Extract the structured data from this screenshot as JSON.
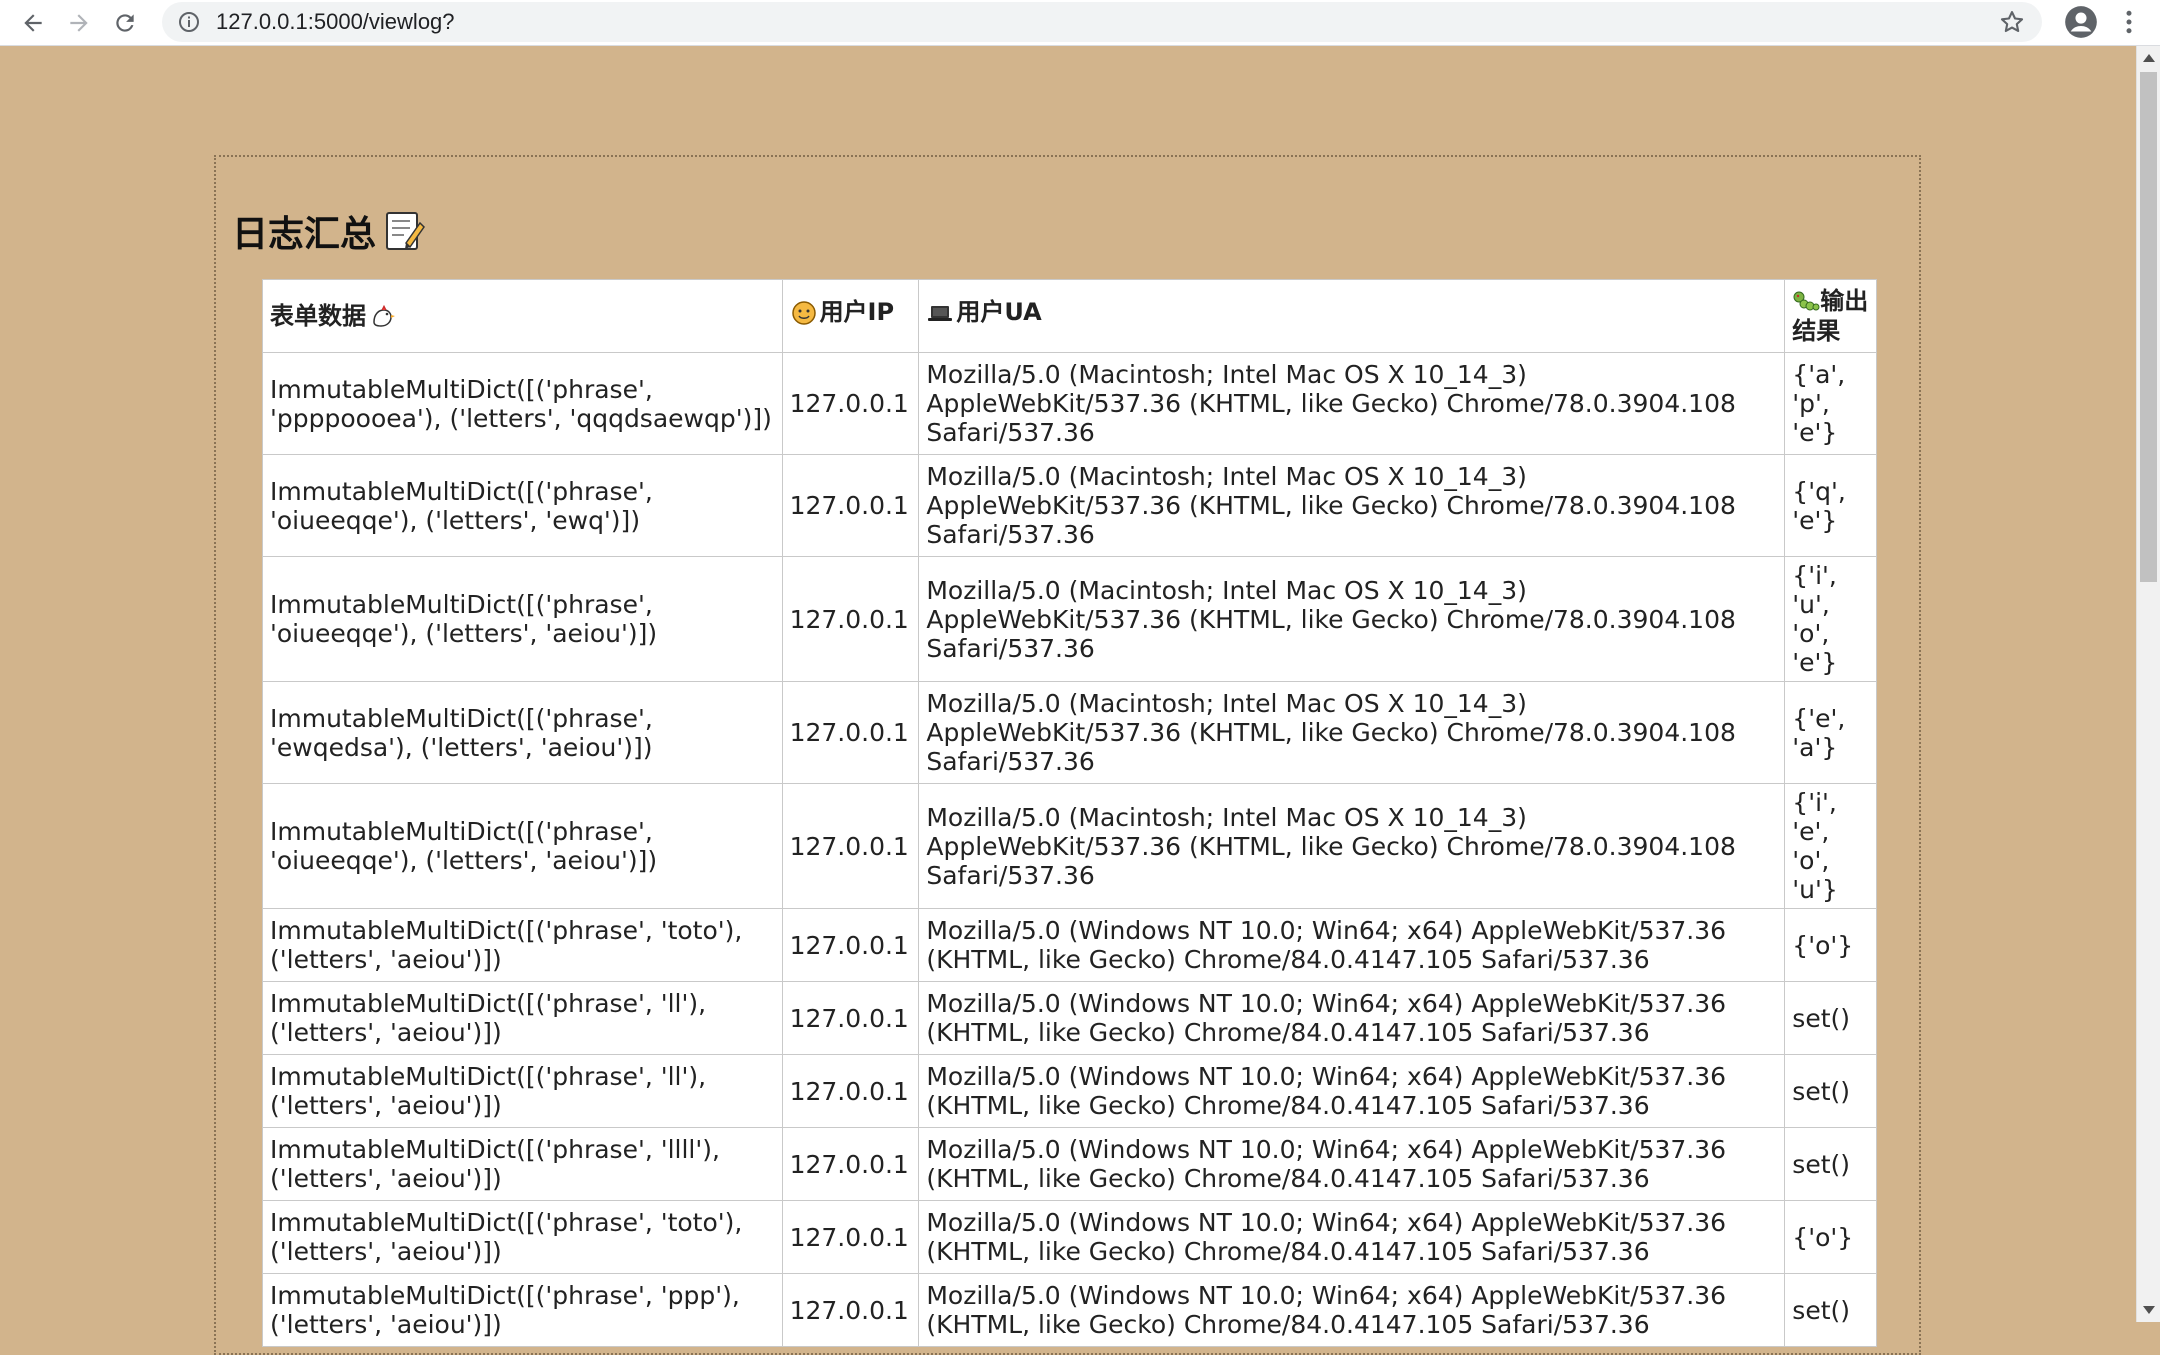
{
  "browser": {
    "url": "127.0.0.1:5000/viewlog?"
  },
  "page": {
    "title": "日志汇总"
  },
  "table": {
    "headers": {
      "form": "表单数据",
      "ip": "用户IP",
      "ua": "用户UA",
      "result": "输出结果"
    },
    "rows": [
      {
        "form": "ImmutableMultiDict([('phrase', 'ppppoooea'), ('letters', 'qqqdsaewqp')])",
        "ip": "127.0.0.1",
        "ua": "Mozilla/5.0 (Macintosh; Intel Mac OS X 10_14_3) AppleWebKit/537.36 (KHTML, like Gecko) Chrome/78.0.3904.108 Safari/537.36",
        "result": "{'a', 'p', 'e'}"
      },
      {
        "form": "ImmutableMultiDict([('phrase', 'oiueeqqe'), ('letters', 'ewq')])",
        "ip": "127.0.0.1",
        "ua": "Mozilla/5.0 (Macintosh; Intel Mac OS X 10_14_3) AppleWebKit/537.36 (KHTML, like Gecko) Chrome/78.0.3904.108 Safari/537.36",
        "result": "{'q', 'e'}"
      },
      {
        "form": "ImmutableMultiDict([('phrase', 'oiueeqqe'), ('letters', 'aeiou')])",
        "ip": "127.0.0.1",
        "ua": "Mozilla/5.0 (Macintosh; Intel Mac OS X 10_14_3) AppleWebKit/537.36 (KHTML, like Gecko) Chrome/78.0.3904.108 Safari/537.36",
        "result": "{'i', 'u', 'o', 'e'}"
      },
      {
        "form": "ImmutableMultiDict([('phrase', 'ewqedsa'), ('letters', 'aeiou')])",
        "ip": "127.0.0.1",
        "ua": "Mozilla/5.0 (Macintosh; Intel Mac OS X 10_14_3) AppleWebKit/537.36 (KHTML, like Gecko) Chrome/78.0.3904.108 Safari/537.36",
        "result": "{'e', 'a'}"
      },
      {
        "form": "ImmutableMultiDict([('phrase', 'oiueeqqe'), ('letters', 'aeiou')])",
        "ip": "127.0.0.1",
        "ua": "Mozilla/5.0 (Macintosh; Intel Mac OS X 10_14_3) AppleWebKit/537.36 (KHTML, like Gecko) Chrome/78.0.3904.108 Safari/537.36",
        "result": "{'i', 'e', 'o', 'u'}"
      },
      {
        "form": "ImmutableMultiDict([('phrase', 'toto'), ('letters', 'aeiou')])",
        "ip": "127.0.0.1",
        "ua": "Mozilla/5.0 (Windows NT 10.0; Win64; x64) AppleWebKit/537.36 (KHTML, like Gecko) Chrome/84.0.4147.105 Safari/537.36",
        "result": "{'o'}"
      },
      {
        "form": "ImmutableMultiDict([('phrase', 'll'), ('letters', 'aeiou')])",
        "ip": "127.0.0.1",
        "ua": "Mozilla/5.0 (Windows NT 10.0; Win64; x64) AppleWebKit/537.36 (KHTML, like Gecko) Chrome/84.0.4147.105 Safari/537.36",
        "result": "set()"
      },
      {
        "form": "ImmutableMultiDict([('phrase', 'll'), ('letters', 'aeiou')])",
        "ip": "127.0.0.1",
        "ua": "Mozilla/5.0 (Windows NT 10.0; Win64; x64) AppleWebKit/537.36 (KHTML, like Gecko) Chrome/84.0.4147.105 Safari/537.36",
        "result": "set()"
      },
      {
        "form": "ImmutableMultiDict([('phrase', 'llll'), ('letters', 'aeiou')])",
        "ip": "127.0.0.1",
        "ua": "Mozilla/5.0 (Windows NT 10.0; Win64; x64) AppleWebKit/537.36 (KHTML, like Gecko) Chrome/84.0.4147.105 Safari/537.36",
        "result": "set()"
      },
      {
        "form": "ImmutableMultiDict([('phrase', 'toto'), ('letters', 'aeiou')])",
        "ip": "127.0.0.1",
        "ua": "Mozilla/5.0 (Windows NT 10.0; Win64; x64) AppleWebKit/537.36 (KHTML, like Gecko) Chrome/84.0.4147.105 Safari/537.36",
        "result": "{'o'}"
      },
      {
        "form": "ImmutableMultiDict([('phrase', 'ppp'), ('letters', 'aeiou')])",
        "ip": "127.0.0.1",
        "ua": "Mozilla/5.0 (Windows NT 10.0; Win64; x64) AppleWebKit/537.36 (KHTML, like Gecko) Chrome/84.0.4147.105 Safari/537.36",
        "result": "set()"
      }
    ]
  },
  "colors": {
    "page_background": "#d2b48c",
    "table_background": "#ffffff"
  }
}
